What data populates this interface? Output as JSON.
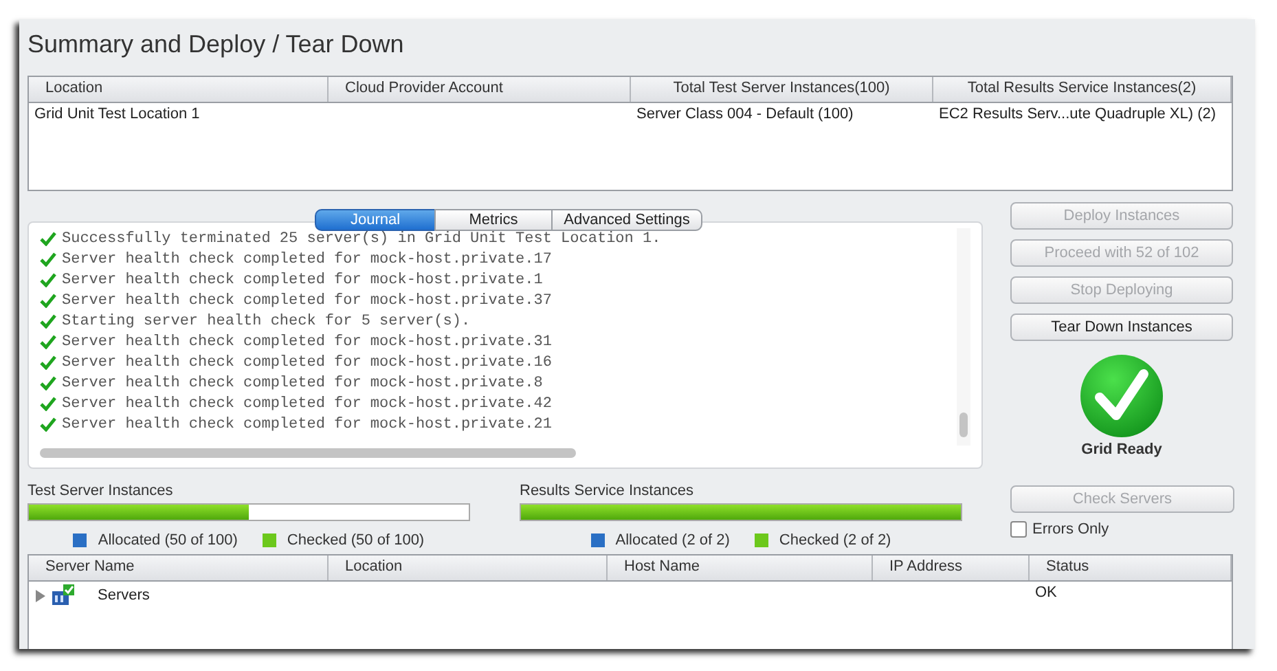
{
  "title": "Summary and Deploy / Tear Down",
  "summary_table": {
    "columns": [
      "Location",
      "Cloud Provider Account",
      "Total Test Server Instances(100)",
      "Total Results Service Instances(2)"
    ],
    "rows": [
      [
        "Grid Unit Test Location 1",
        "",
        "Server Class 004 - Default (100)",
        "EC2 Results Serv...ute Quadruple XL) (2)"
      ]
    ]
  },
  "tabs": [
    {
      "label": "Journal",
      "selected": true
    },
    {
      "label": "Metrics",
      "selected": false
    },
    {
      "label": "Advanced Settings",
      "selected": false
    }
  ],
  "journal": [
    {
      "text": "Successfully terminated 25 server(s) in Grid Unit Test Location 1.",
      "kind": "success"
    },
    {
      "text": "Server health check completed for mock-host.private.17",
      "kind": "success"
    },
    {
      "text": "Server health check completed for mock-host.private.1",
      "kind": "success"
    },
    {
      "text": "Server health check completed for mock-host.private.37",
      "kind": "success"
    },
    {
      "text": "Starting server health check for 5 server(s).",
      "kind": "success"
    },
    {
      "text": "Server health check completed for mock-host.private.31",
      "kind": "success"
    },
    {
      "text": "Server health check completed for mock-host.private.16",
      "kind": "success"
    },
    {
      "text": "Server health check completed for mock-host.private.8",
      "kind": "success"
    },
    {
      "text": "Server health check completed for mock-host.private.42",
      "kind": "success"
    },
    {
      "text": "Server health check completed for mock-host.private.21",
      "kind": "success"
    }
  ],
  "actions": [
    {
      "label": "Deploy Instances",
      "disabled": true
    },
    {
      "label": "Proceed with 52 of 102",
      "disabled": true
    },
    {
      "label": "Stop Deploying",
      "disabled": true
    },
    {
      "label": "Tear Down Instances",
      "disabled": false
    }
  ],
  "status": {
    "label": "Grid Ready",
    "kind": "ready"
  },
  "progress": [
    {
      "label": "Test Server Instances",
      "level": 0.5,
      "legend": [
        {
          "label": "Allocated (50 of 100)",
          "color": "#2a6fc4"
        },
        {
          "label": "Checked (50 of 100)",
          "color": "#6cc81c"
        }
      ]
    },
    {
      "label": "Results Service Instances",
      "level": 1,
      "legend": [
        {
          "label": "Allocated (2 of 2)",
          "color": "#2a6fc4"
        },
        {
          "label": "Checked (2 of 2)",
          "color": "#6cc81c"
        }
      ]
    }
  ],
  "check_servers": {
    "label": "Check Servers",
    "disabled": true
  },
  "errors_only": {
    "label": "Errors Only",
    "checked": false
  },
  "servers_table": {
    "columns": [
      "Server Name",
      "Location",
      "Host Name",
      "IP Address",
      "Status"
    ],
    "rows": [
      {
        "cells": [
          "Servers",
          "",
          "",
          "",
          "OK"
        ],
        "expanded": false
      }
    ]
  }
}
